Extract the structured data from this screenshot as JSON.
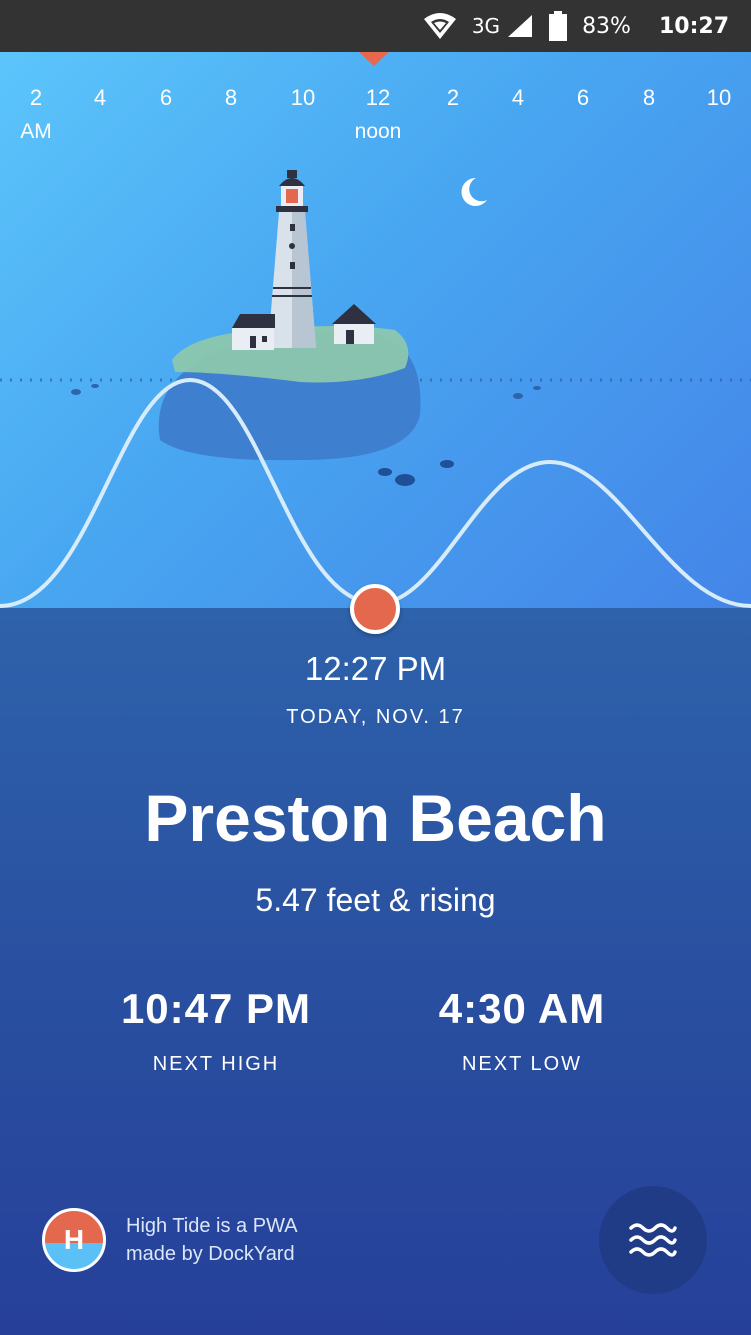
{
  "status_bar": {
    "network": "3G",
    "battery": "83%",
    "time": "10:27",
    "icons": [
      "wifi-icon",
      "cell-signal-icon",
      "battery-icon"
    ]
  },
  "timeline": {
    "ticks": [
      {
        "label": "2",
        "sub": "AM"
      },
      {
        "label": "4",
        "sub": ""
      },
      {
        "label": "6",
        "sub": ""
      },
      {
        "label": "8",
        "sub": ""
      },
      {
        "label": "10",
        "sub": ""
      },
      {
        "label": "12",
        "sub": "noon"
      },
      {
        "label": "2",
        "sub": ""
      },
      {
        "label": "4",
        "sub": ""
      },
      {
        "label": "6",
        "sub": ""
      },
      {
        "label": "8",
        "sub": ""
      },
      {
        "label": "10",
        "sub": ""
      }
    ]
  },
  "current": {
    "time": "12:27 PM",
    "date": "TODAY, NOV. 17"
  },
  "location": {
    "name": "Preston Beach",
    "status": "5.47 feet & rising"
  },
  "next_high": {
    "time": "10:47 PM",
    "label": "NEXT HIGH"
  },
  "next_low": {
    "time": "4:30 AM",
    "label": "NEXT LOW"
  },
  "footer": {
    "logo_letter": "H",
    "line1": "High Tide is a PWA",
    "line2": "made by DockYard"
  },
  "colors": {
    "accent": "#e4684e",
    "sea": "#2a4f9c",
    "sky": "#48a6f1",
    "status_bar": "#333333"
  }
}
